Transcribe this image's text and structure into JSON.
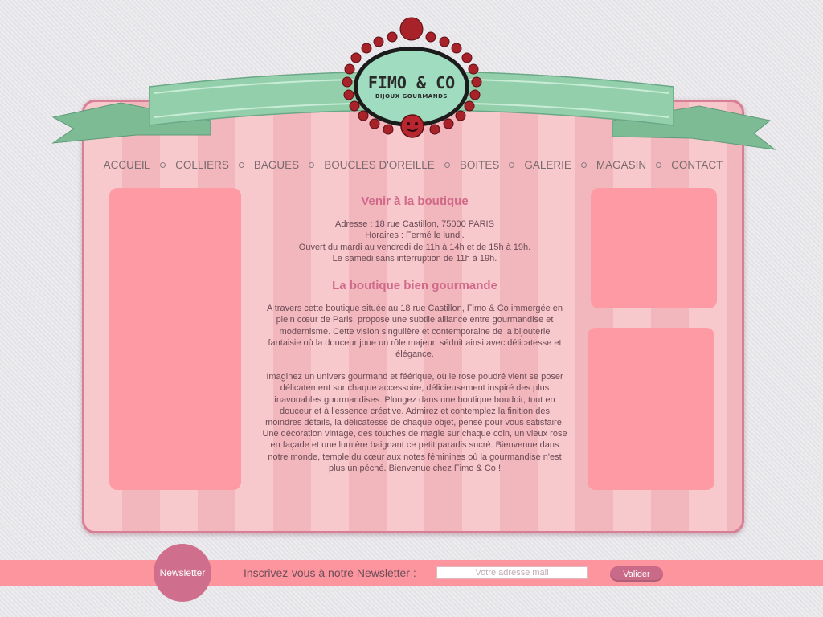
{
  "logo": {
    "title": "FIMO & CO",
    "subtitle": "BIJOUX GOURMANDS"
  },
  "nav": [
    {
      "label": "ACCUEIL"
    },
    {
      "label": "COLLIERS"
    },
    {
      "label": "BAGUES"
    },
    {
      "label": "BOUCLES D'OREILLE"
    },
    {
      "label": "BOITES"
    },
    {
      "label": "GALERIE"
    },
    {
      "label": "MAGASIN"
    },
    {
      "label": "CONTACT"
    }
  ],
  "content": {
    "heading1": "Venir à la boutique",
    "address_lines": [
      "Adresse : 18 rue Castillon, 75000 PARIS",
      "Horaires : Fermé le lundi.",
      "Ouvert du mardi au vendredi de 11h à 14h et de 15h à 19h.",
      "Le samedi sans interruption de 11h à 19h."
    ],
    "heading2": "La boutique bien gourmande",
    "para1": "A travers cette boutique située au 18 rue Castillon, Fimo & Co immergée en plein cœur de Paris, propose une subtile alliance entre gourmandise et modernisme. Cette vision singulière et contemporaine de la bijouterie fantaisie où la douceur joue un rôle majeur, séduit ainsi avec délicatesse et élégance.",
    "para2": "Imaginez un univers gourmand et féérique, où le rose poudré vient se poser délicatement sur chaque accessoire, délicieusement inspiré des plus inavouables gourmandises. Plongez dans une boutique boudoir, tout en douceur et à l'essence créative. Admirez et contemplez la finition des moindres détails, la délicatesse de chaque objet, pensé pour vous satisfaire. Une décoration vintage, des touches de magie sur chaque coin, un vieux rose en façade et une lumière baignant ce petit paradis sucré. Bienvenue dans notre monde, temple du cœur aux notes féminines où la gourmandise n'est plus un péché. Bienvenue chez Fimo & Co !"
  },
  "newsletter": {
    "badge": "Newsletter",
    "label": "Inscrivez-vous à notre Newsletter :",
    "placeholder": "Votre adresse mail",
    "button": "Valider"
  },
  "colors": {
    "pink_box": "#fe9aa3",
    "heading": "#d0698a",
    "ribbon": "#8fcaa6",
    "bead": "#a8222a",
    "newsletter_bar": "#fc959e",
    "newsletter_badge": "#cf6f8d"
  }
}
